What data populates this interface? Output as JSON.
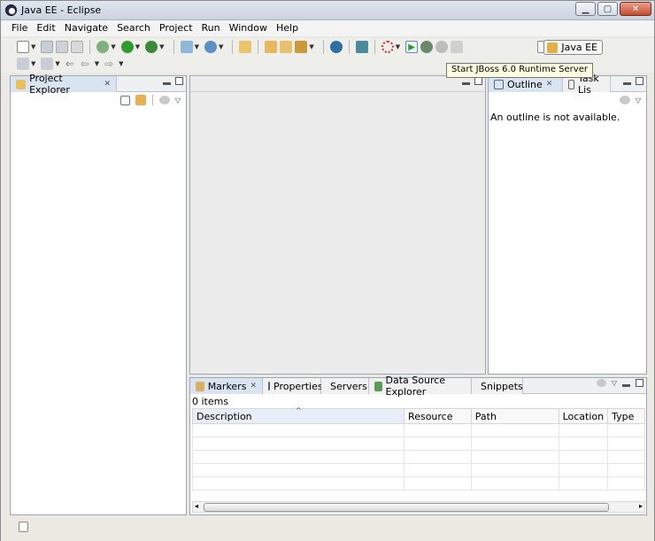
{
  "window": {
    "title": "Java EE - Eclipse"
  },
  "menu": [
    "File",
    "Edit",
    "Navigate",
    "Search",
    "Project",
    "Run",
    "Window",
    "Help"
  ],
  "toolbar": {
    "perspective_label": "Java EE",
    "tooltip": "Start JBoss 6.0 Runtime Server"
  },
  "project_explorer": {
    "tab_label": "Project Explorer"
  },
  "outline": {
    "tab_label": "Outline",
    "task_tab_label": "Task Lis",
    "message": "An outline is not available."
  },
  "bottom": {
    "tabs": [
      "Markers",
      "Properties",
      "Servers",
      "Data Source Explorer",
      "Snippets"
    ],
    "item_count": "0 items",
    "columns": [
      "Description",
      "Resource",
      "Path",
      "Location",
      "Type"
    ]
  },
  "colors": {
    "accent": "#d8e4f0",
    "run_green": "#2e9d2e"
  }
}
